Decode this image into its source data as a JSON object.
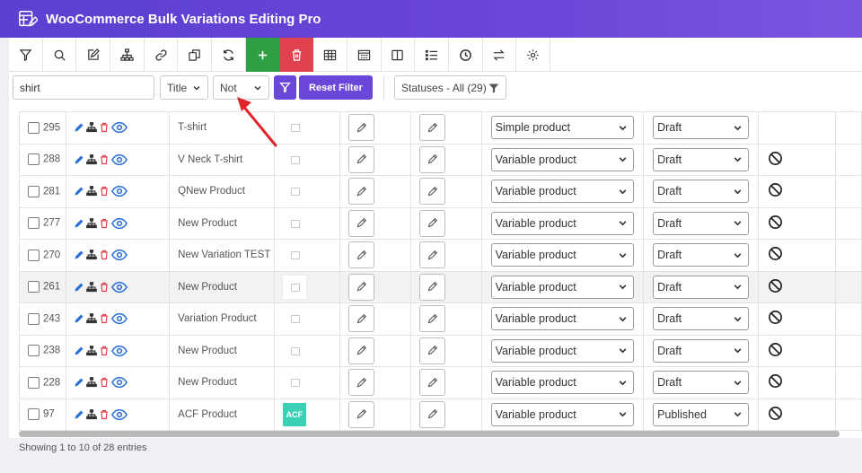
{
  "app": {
    "title": "WooCommerce Bulk Variations Editing Pro"
  },
  "toolbar": {
    "buttons": [
      {
        "icon": "filter-icon"
      },
      {
        "icon": "search-icon"
      },
      {
        "icon": "edit-icon"
      },
      {
        "icon": "hierarchy-icon"
      },
      {
        "icon": "link-icon"
      },
      {
        "icon": "copy-icon"
      },
      {
        "icon": "refresh-icon"
      },
      {
        "icon": "plus-icon"
      },
      {
        "icon": "trash-icon"
      },
      {
        "icon": "table-icon"
      },
      {
        "icon": "columns-icon"
      },
      {
        "icon": "split-icon"
      },
      {
        "icon": "list-icon"
      },
      {
        "icon": "clock-icon"
      },
      {
        "icon": "swap-icon"
      },
      {
        "icon": "gear-icon"
      }
    ],
    "colors": {
      "add": "#2ea043",
      "delete": "#e0434f"
    }
  },
  "filter": {
    "search_value": "shirt",
    "field_select": "Title",
    "operator_select": "Not",
    "reset_label": "Reset Filter",
    "status_select": "Statuses - All (29)"
  },
  "rows": [
    {
      "id": "295",
      "name": "T-shirt",
      "type": "Simple product",
      "status": "Draft",
      "banned": false,
      "thumb": "placeholder"
    },
    {
      "id": "288",
      "name": "V Neck T-shirt",
      "type": "Variable product",
      "status": "Draft",
      "banned": true,
      "thumb": "placeholder"
    },
    {
      "id": "281",
      "name": "QNew Product",
      "type": "Variable product",
      "status": "Draft",
      "banned": true,
      "thumb": "placeholder"
    },
    {
      "id": "277",
      "name": "New Product",
      "type": "Variable product",
      "status": "Draft",
      "banned": true,
      "thumb": "placeholder"
    },
    {
      "id": "270",
      "name": "New Variation TEST",
      "type": "Variable product",
      "status": "Draft",
      "banned": true,
      "thumb": "placeholder"
    },
    {
      "id": "261",
      "name": "New Product",
      "type": "Variable product",
      "status": "Draft",
      "banned": true,
      "thumb": "placeholder-white"
    },
    {
      "id": "243",
      "name": "Variation Product",
      "type": "Variable product",
      "status": "Draft",
      "banned": true,
      "thumb": "placeholder"
    },
    {
      "id": "238",
      "name": "New Product",
      "type": "Variable product",
      "status": "Draft",
      "banned": true,
      "thumb": "placeholder"
    },
    {
      "id": "228",
      "name": "New Product",
      "type": "Variable product",
      "status": "Draft",
      "banned": true,
      "thumb": "placeholder"
    },
    {
      "id": "97",
      "name": "ACF Product",
      "type": "Variable product",
      "status": "Published",
      "banned": true,
      "thumb": "ACF"
    }
  ],
  "footer": {
    "entries_text": "Showing 1 to 10 of 28 entries"
  },
  "colors": {
    "accent": "#6a46d9",
    "header": "#5b3fd0",
    "icon_blue": "#2a6fd6",
    "icon_red": "#e0434f",
    "annotation_arrow": "#e0262b"
  }
}
